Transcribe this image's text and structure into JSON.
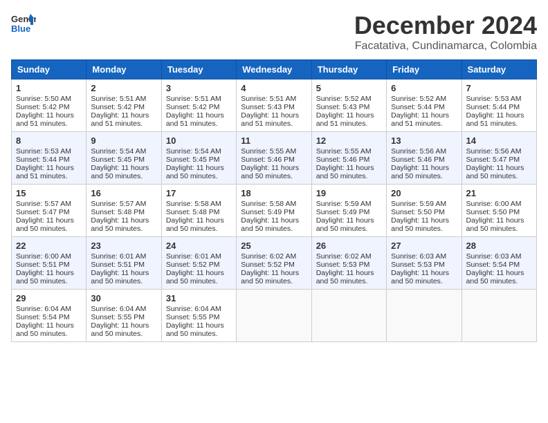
{
  "header": {
    "logo_line1": "General",
    "logo_line2": "Blue",
    "main_title": "December 2024",
    "subtitle": "Facatativa, Cundinamarca, Colombia"
  },
  "columns": [
    "Sunday",
    "Monday",
    "Tuesday",
    "Wednesday",
    "Thursday",
    "Friday",
    "Saturday"
  ],
  "weeks": [
    [
      {
        "day": "1",
        "lines": [
          "Sunrise: 5:50 AM",
          "Sunset: 5:42 PM",
          "Daylight: 11 hours",
          "and 51 minutes."
        ]
      },
      {
        "day": "2",
        "lines": [
          "Sunrise: 5:51 AM",
          "Sunset: 5:42 PM",
          "Daylight: 11 hours",
          "and 51 minutes."
        ]
      },
      {
        "day": "3",
        "lines": [
          "Sunrise: 5:51 AM",
          "Sunset: 5:42 PM",
          "Daylight: 11 hours",
          "and 51 minutes."
        ]
      },
      {
        "day": "4",
        "lines": [
          "Sunrise: 5:51 AM",
          "Sunset: 5:43 PM",
          "Daylight: 11 hours",
          "and 51 minutes."
        ]
      },
      {
        "day": "5",
        "lines": [
          "Sunrise: 5:52 AM",
          "Sunset: 5:43 PM",
          "Daylight: 11 hours",
          "and 51 minutes."
        ]
      },
      {
        "day": "6",
        "lines": [
          "Sunrise: 5:52 AM",
          "Sunset: 5:44 PM",
          "Daylight: 11 hours",
          "and 51 minutes."
        ]
      },
      {
        "day": "7",
        "lines": [
          "Sunrise: 5:53 AM",
          "Sunset: 5:44 PM",
          "Daylight: 11 hours",
          "and 51 minutes."
        ]
      }
    ],
    [
      {
        "day": "8",
        "lines": [
          "Sunrise: 5:53 AM",
          "Sunset: 5:44 PM",
          "Daylight: 11 hours",
          "and 51 minutes."
        ]
      },
      {
        "day": "9",
        "lines": [
          "Sunrise: 5:54 AM",
          "Sunset: 5:45 PM",
          "Daylight: 11 hours",
          "and 50 minutes."
        ]
      },
      {
        "day": "10",
        "lines": [
          "Sunrise: 5:54 AM",
          "Sunset: 5:45 PM",
          "Daylight: 11 hours",
          "and 50 minutes."
        ]
      },
      {
        "day": "11",
        "lines": [
          "Sunrise: 5:55 AM",
          "Sunset: 5:46 PM",
          "Daylight: 11 hours",
          "and 50 minutes."
        ]
      },
      {
        "day": "12",
        "lines": [
          "Sunrise: 5:55 AM",
          "Sunset: 5:46 PM",
          "Daylight: 11 hours",
          "and 50 minutes."
        ]
      },
      {
        "day": "13",
        "lines": [
          "Sunrise: 5:56 AM",
          "Sunset: 5:46 PM",
          "Daylight: 11 hours",
          "and 50 minutes."
        ]
      },
      {
        "day": "14",
        "lines": [
          "Sunrise: 5:56 AM",
          "Sunset: 5:47 PM",
          "Daylight: 11 hours",
          "and 50 minutes."
        ]
      }
    ],
    [
      {
        "day": "15",
        "lines": [
          "Sunrise: 5:57 AM",
          "Sunset: 5:47 PM",
          "Daylight: 11 hours",
          "and 50 minutes."
        ]
      },
      {
        "day": "16",
        "lines": [
          "Sunrise: 5:57 AM",
          "Sunset: 5:48 PM",
          "Daylight: 11 hours",
          "and 50 minutes."
        ]
      },
      {
        "day": "17",
        "lines": [
          "Sunrise: 5:58 AM",
          "Sunset: 5:48 PM",
          "Daylight: 11 hours",
          "and 50 minutes."
        ]
      },
      {
        "day": "18",
        "lines": [
          "Sunrise: 5:58 AM",
          "Sunset: 5:49 PM",
          "Daylight: 11 hours",
          "and 50 minutes."
        ]
      },
      {
        "day": "19",
        "lines": [
          "Sunrise: 5:59 AM",
          "Sunset: 5:49 PM",
          "Daylight: 11 hours",
          "and 50 minutes."
        ]
      },
      {
        "day": "20",
        "lines": [
          "Sunrise: 5:59 AM",
          "Sunset: 5:50 PM",
          "Daylight: 11 hours",
          "and 50 minutes."
        ]
      },
      {
        "day": "21",
        "lines": [
          "Sunrise: 6:00 AM",
          "Sunset: 5:50 PM",
          "Daylight: 11 hours",
          "and 50 minutes."
        ]
      }
    ],
    [
      {
        "day": "22",
        "lines": [
          "Sunrise: 6:00 AM",
          "Sunset: 5:51 PM",
          "Daylight: 11 hours",
          "and 50 minutes."
        ]
      },
      {
        "day": "23",
        "lines": [
          "Sunrise: 6:01 AM",
          "Sunset: 5:51 PM",
          "Daylight: 11 hours",
          "and 50 minutes."
        ]
      },
      {
        "day": "24",
        "lines": [
          "Sunrise: 6:01 AM",
          "Sunset: 5:52 PM",
          "Daylight: 11 hours",
          "and 50 minutes."
        ]
      },
      {
        "day": "25",
        "lines": [
          "Sunrise: 6:02 AM",
          "Sunset: 5:52 PM",
          "Daylight: 11 hours",
          "and 50 minutes."
        ]
      },
      {
        "day": "26",
        "lines": [
          "Sunrise: 6:02 AM",
          "Sunset: 5:53 PM",
          "Daylight: 11 hours",
          "and 50 minutes."
        ]
      },
      {
        "day": "27",
        "lines": [
          "Sunrise: 6:03 AM",
          "Sunset: 5:53 PM",
          "Daylight: 11 hours",
          "and 50 minutes."
        ]
      },
      {
        "day": "28",
        "lines": [
          "Sunrise: 6:03 AM",
          "Sunset: 5:54 PM",
          "Daylight: 11 hours",
          "and 50 minutes."
        ]
      }
    ],
    [
      {
        "day": "29",
        "lines": [
          "Sunrise: 6:04 AM",
          "Sunset: 5:54 PM",
          "Daylight: 11 hours",
          "and 50 minutes."
        ]
      },
      {
        "day": "30",
        "lines": [
          "Sunrise: 6:04 AM",
          "Sunset: 5:55 PM",
          "Daylight: 11 hours",
          "and 50 minutes."
        ]
      },
      {
        "day": "31",
        "lines": [
          "Sunrise: 6:04 AM",
          "Sunset: 5:55 PM",
          "Daylight: 11 hours",
          "and 50 minutes."
        ]
      },
      {
        "day": "",
        "lines": []
      },
      {
        "day": "",
        "lines": []
      },
      {
        "day": "",
        "lines": []
      },
      {
        "day": "",
        "lines": []
      }
    ]
  ]
}
